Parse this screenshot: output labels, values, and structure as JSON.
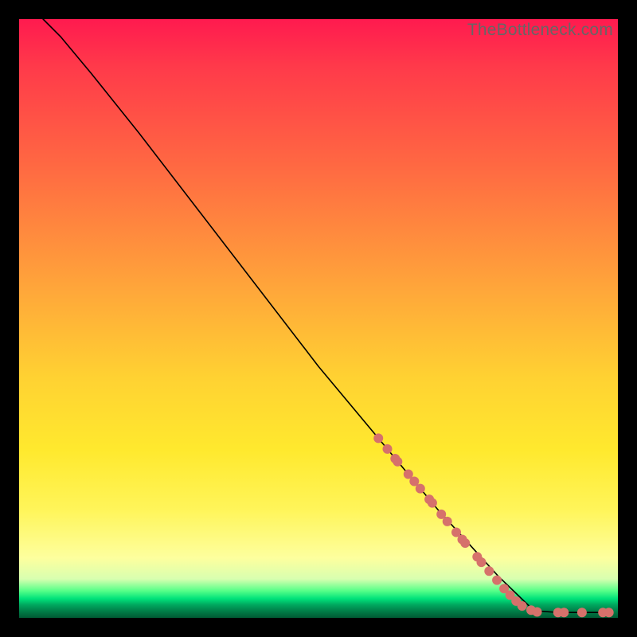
{
  "watermark": "TheBottleneck.com",
  "chart_data": {
    "type": "line",
    "title": "",
    "xlabel": "",
    "ylabel": "",
    "xlim": [
      0,
      100
    ],
    "ylim": [
      0,
      100
    ],
    "curve": {
      "name": "bottleneck-curve",
      "points": [
        {
          "x": 4,
          "y": 100
        },
        {
          "x": 7,
          "y": 97
        },
        {
          "x": 12,
          "y": 91
        },
        {
          "x": 20,
          "y": 81
        },
        {
          "x": 30,
          "y": 68
        },
        {
          "x": 40,
          "y": 55
        },
        {
          "x": 50,
          "y": 42
        },
        {
          "x": 60,
          "y": 30
        },
        {
          "x": 70,
          "y": 18
        },
        {
          "x": 80,
          "y": 7
        },
        {
          "x": 86,
          "y": 1.2
        },
        {
          "x": 90,
          "y": 0.9
        },
        {
          "x": 94,
          "y": 0.9
        },
        {
          "x": 98,
          "y": 0.9
        }
      ]
    },
    "markers": {
      "name": "sample-points",
      "color": "#d6716b",
      "radius_px": 6,
      "points": [
        {
          "x": 60,
          "y": 30
        },
        {
          "x": 61.5,
          "y": 28.2
        },
        {
          "x": 62.8,
          "y": 26.6
        },
        {
          "x": 63.2,
          "y": 26.1
        },
        {
          "x": 65,
          "y": 24
        },
        {
          "x": 66,
          "y": 22.8
        },
        {
          "x": 67,
          "y": 21.6
        },
        {
          "x": 68.5,
          "y": 19.8
        },
        {
          "x": 69,
          "y": 19.2
        },
        {
          "x": 70.5,
          "y": 17.3
        },
        {
          "x": 71.5,
          "y": 16.1
        },
        {
          "x": 73,
          "y": 14.3
        },
        {
          "x": 74,
          "y": 13.1
        },
        {
          "x": 74.5,
          "y": 12.5
        },
        {
          "x": 76.5,
          "y": 10.2
        },
        {
          "x": 77.2,
          "y": 9.3
        },
        {
          "x": 78.5,
          "y": 7.8
        },
        {
          "x": 79.8,
          "y": 6.3
        },
        {
          "x": 81,
          "y": 4.9
        },
        {
          "x": 82,
          "y": 3.8
        },
        {
          "x": 83,
          "y": 2.8
        },
        {
          "x": 84,
          "y": 2.0
        },
        {
          "x": 85.5,
          "y": 1.3
        },
        {
          "x": 86.5,
          "y": 1.0
        },
        {
          "x": 90,
          "y": 0.9
        },
        {
          "x": 91,
          "y": 0.9
        },
        {
          "x": 94,
          "y": 0.9
        },
        {
          "x": 97.5,
          "y": 0.9
        },
        {
          "x": 98.5,
          "y": 0.9
        }
      ]
    }
  }
}
